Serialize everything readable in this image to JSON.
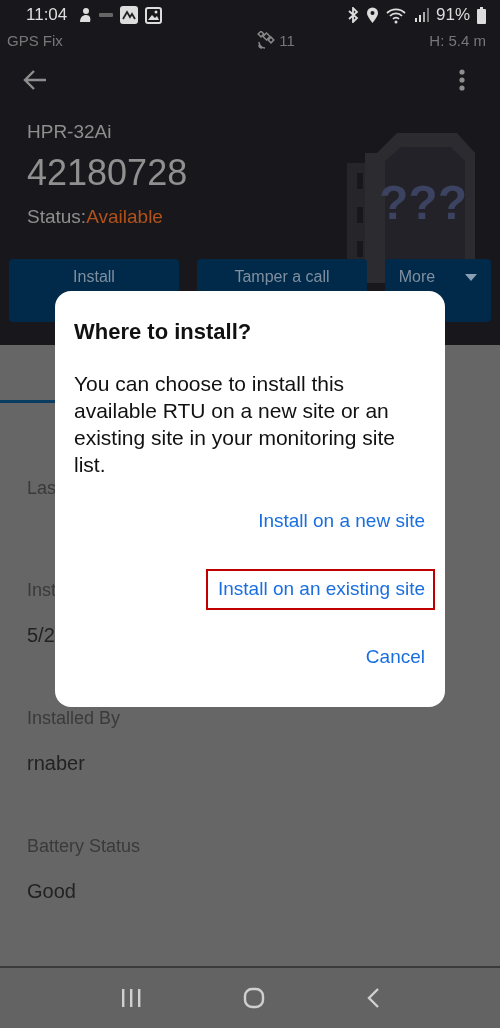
{
  "status_bar": {
    "time": "11:04",
    "battery": "91%"
  },
  "gps_bar": {
    "fix": "GPS Fix",
    "satellites": "11",
    "height": "H: 5.4 m"
  },
  "device": {
    "model": "HPR-32Ai",
    "serial": "42180728",
    "status_label": "Status:",
    "status_value": "Available",
    "art_text": "???"
  },
  "actions": [
    {
      "label": "Install",
      "kind": "plain"
    },
    {
      "label": "Tamper a call",
      "kind": "plain"
    },
    {
      "label": "More",
      "kind": "dropdown"
    }
  ],
  "fields": [
    {
      "label": "Las"
    },
    {
      "label": "Inst",
      "value": "5/2"
    },
    {
      "label": "Installed By",
      "value": "rnaber"
    },
    {
      "label": "Battery Status",
      "value": "Good"
    }
  ],
  "dialog": {
    "title": "Where to install?",
    "message": "You can choose to install this available RTU on a new site or an existing site in your monitoring site list.",
    "buttons": [
      {
        "label": "Install on a new site",
        "highlighted": false
      },
      {
        "label": "Install on an existing site",
        "highlighted": true
      },
      {
        "label": "Cancel",
        "highlighted": false
      }
    ]
  }
}
